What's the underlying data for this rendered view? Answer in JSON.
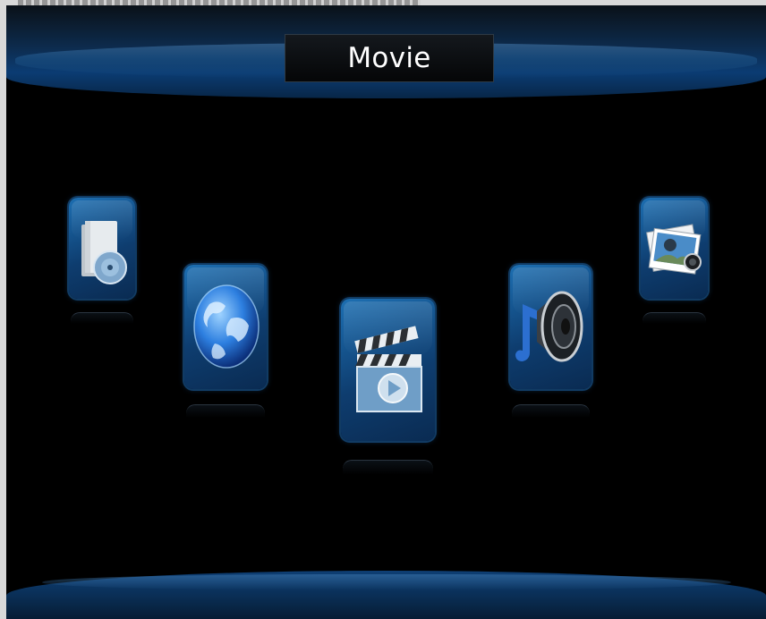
{
  "header": {
    "title": "Movie"
  },
  "menu": {
    "items": [
      {
        "id": "file",
        "icon": "disc-folder-icon"
      },
      {
        "id": "internet",
        "icon": "globe-icon"
      },
      {
        "id": "movie",
        "icon": "clapperboard-play-icon",
        "selected": true
      },
      {
        "id": "music",
        "icon": "speaker-music-icon"
      },
      {
        "id": "photo",
        "icon": "photo-stack-icon"
      }
    ]
  },
  "colors": {
    "background": "#000000",
    "bar_blue": "#0b3c73",
    "tile_blue": "#1d6fb2",
    "title_text": "#ffffff"
  }
}
